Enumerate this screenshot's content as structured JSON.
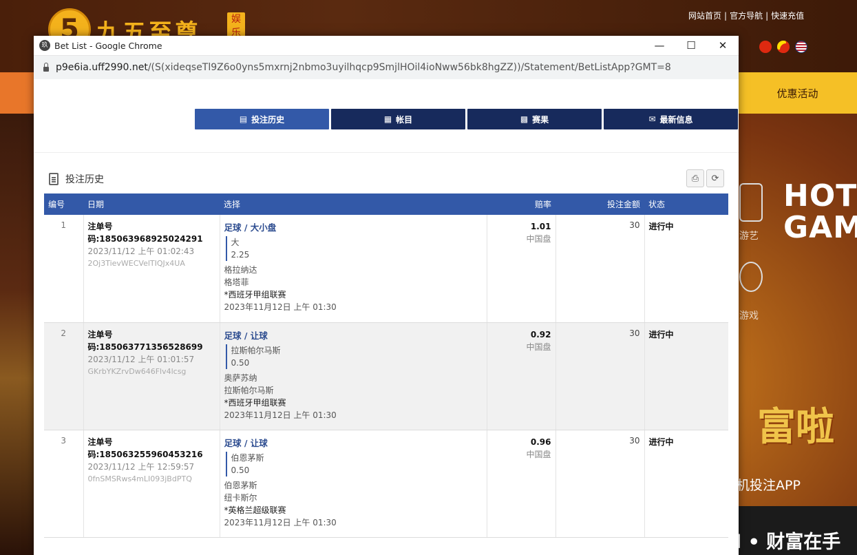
{
  "site": {
    "logo_mark": "5",
    "logo_text": "九五至尊",
    "logo_badge": "娱乐",
    "top_links": [
      "网站首页",
      "官方导航",
      "快速充值"
    ],
    "promo_tab": "优惠活动",
    "side_items": [
      "游艺",
      "游戏"
    ],
    "hot_game": "HOT GAME",
    "banner_big": "富啦",
    "app_line": "机投注APP",
    "bottom_text": "l • 财富在手"
  },
  "browser": {
    "title": "Bet List - Google Chrome",
    "url_host": "p9e6ia.uff2990.net",
    "url_path": "/(S(xideqseTl9Z6o0yns5mxrnj2nbmo3uyilhqcp9SmjlHOil4ioNww56bk8hgZZ))/Statement/BetListApp?GMT=8"
  },
  "nav": {
    "tabs": [
      {
        "label": "投注历史",
        "icon": "clipboard-icon",
        "active": true
      },
      {
        "label": "帐目",
        "icon": "ledger-icon",
        "active": false
      },
      {
        "label": "赛果",
        "icon": "results-icon",
        "active": false
      },
      {
        "label": "最新信息",
        "icon": "mail-icon",
        "active": false
      }
    ]
  },
  "section": {
    "title": "投注历史"
  },
  "table": {
    "headers": [
      "编号",
      "日期",
      "选择",
      "赔率",
      "投注金额",
      "状态"
    ],
    "rows": [
      {
        "num": "1",
        "ticket": "注单号码:185063968925024291",
        "datetime": "2023/11/12 上午 01:02:43",
        "ref": "2Oj3TievWECVelTIQJx4UA",
        "sel_title": "足球 / 大小盘",
        "pick": "大",
        "line": "2.25",
        "team1": "格拉纳达",
        "team2": "格塔菲",
        "league": "*西班牙甲组联赛",
        "match_time": "2023年11月12日 上午 01:30",
        "odds": "1.01",
        "odds_type": "中国盘",
        "amount": "30",
        "status": "进行中"
      },
      {
        "num": "2",
        "ticket": "注单号码:185063771356528699",
        "datetime": "2023/11/12 上午 01:01:57",
        "ref": "GKrbYKZrvDw646Flv4lcsg",
        "sel_title": "足球 / 让球",
        "pick": "拉斯帕尔马斯",
        "line": "0.50",
        "team1": "奥萨苏纳",
        "team2": "拉斯帕尔马斯",
        "league": "*西班牙甲组联赛",
        "match_time": "2023年11月12日 上午 01:30",
        "odds": "0.92",
        "odds_type": "中国盘",
        "amount": "30",
        "status": "进行中"
      },
      {
        "num": "3",
        "ticket": "注单号码:185063255960453216",
        "datetime": "2023/11/12 上午 12:59:57",
        "ref": "0fnSMSRws4mLI093jBdPTQ",
        "sel_title": "足球 / 让球",
        "pick": "伯恩茅斯",
        "line": "0.50",
        "team1": "伯恩茅斯",
        "team2": "纽卡斯尔",
        "league": "*英格兰超级联赛",
        "match_time": "2023年11月12日 上午 01:30",
        "odds": "0.96",
        "odds_type": "中国盘",
        "amount": "30",
        "status": "进行中"
      }
    ]
  },
  "colors": {
    "nav_dark": "#172a5c",
    "nav_active": "#3359a8",
    "header_blue": "#3359a8"
  }
}
